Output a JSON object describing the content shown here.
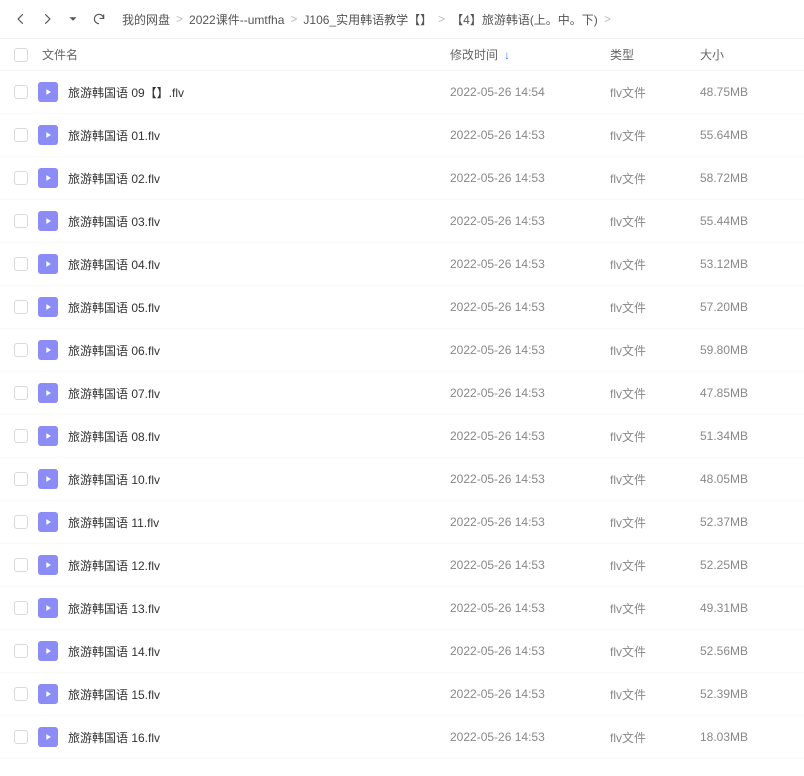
{
  "breadcrumb": {
    "items": [
      {
        "label": "我的网盘"
      },
      {
        "label": "2022课件--umtfha"
      },
      {
        "label": "J106_实用韩语教学【】"
      },
      {
        "label": "【4】旅游韩语(上。中。下)"
      }
    ],
    "separator": ">"
  },
  "columns": {
    "name": "文件名",
    "date": "修改时间",
    "type": "类型",
    "size": "大小"
  },
  "files": [
    {
      "name": "旅游韩国语 09【】.flv",
      "date": "2022-05-26 14:54",
      "type": "flv文件",
      "size": "48.75MB"
    },
    {
      "name": "旅游韩国语 01.flv",
      "date": "2022-05-26 14:53",
      "type": "flv文件",
      "size": "55.64MB"
    },
    {
      "name": "旅游韩国语 02.flv",
      "date": "2022-05-26 14:53",
      "type": "flv文件",
      "size": "58.72MB"
    },
    {
      "name": "旅游韩国语 03.flv",
      "date": "2022-05-26 14:53",
      "type": "flv文件",
      "size": "55.44MB"
    },
    {
      "name": "旅游韩国语 04.flv",
      "date": "2022-05-26 14:53",
      "type": "flv文件",
      "size": "53.12MB"
    },
    {
      "name": "旅游韩国语 05.flv",
      "date": "2022-05-26 14:53",
      "type": "flv文件",
      "size": "57.20MB"
    },
    {
      "name": "旅游韩国语 06.flv",
      "date": "2022-05-26 14:53",
      "type": "flv文件",
      "size": "59.80MB"
    },
    {
      "name": "旅游韩国语 07.flv",
      "date": "2022-05-26 14:53",
      "type": "flv文件",
      "size": "47.85MB"
    },
    {
      "name": "旅游韩国语 08.flv",
      "date": "2022-05-26 14:53",
      "type": "flv文件",
      "size": "51.34MB"
    },
    {
      "name": "旅游韩国语 10.flv",
      "date": "2022-05-26 14:53",
      "type": "flv文件",
      "size": "48.05MB"
    },
    {
      "name": "旅游韩国语 11.flv",
      "date": "2022-05-26 14:53",
      "type": "flv文件",
      "size": "52.37MB"
    },
    {
      "name": "旅游韩国语 12.flv",
      "date": "2022-05-26 14:53",
      "type": "flv文件",
      "size": "52.25MB"
    },
    {
      "name": "旅游韩国语 13.flv",
      "date": "2022-05-26 14:53",
      "type": "flv文件",
      "size": "49.31MB"
    },
    {
      "name": "旅游韩国语 14.flv",
      "date": "2022-05-26 14:53",
      "type": "flv文件",
      "size": "52.56MB"
    },
    {
      "name": "旅游韩国语 15.flv",
      "date": "2022-05-26 14:53",
      "type": "flv文件",
      "size": "52.39MB"
    },
    {
      "name": "旅游韩国语 16.flv",
      "date": "2022-05-26 14:53",
      "type": "flv文件",
      "size": "18.03MB"
    }
  ]
}
